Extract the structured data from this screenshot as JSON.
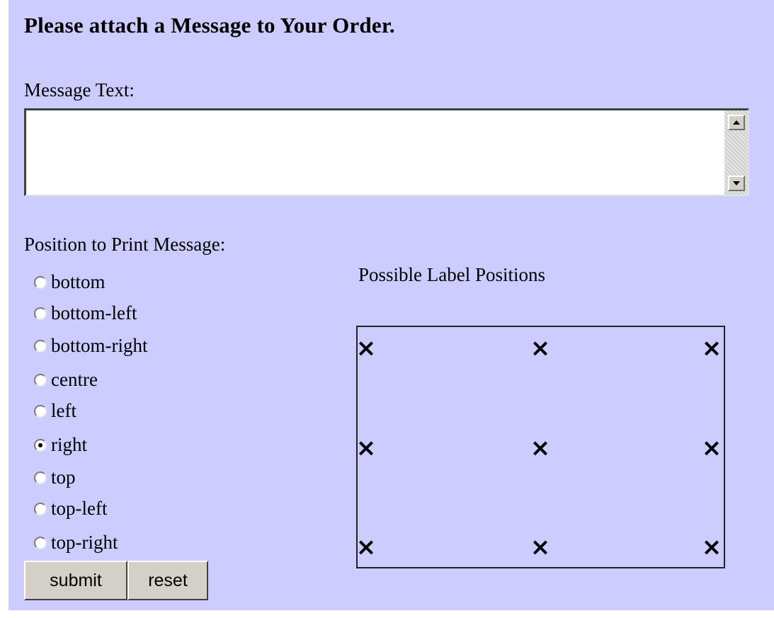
{
  "form": {
    "title": "Please attach a Message to Your Order.",
    "message_label": "Message Text:",
    "message_value": "",
    "position_label": "Position to Print Message:",
    "options": [
      "bottom",
      "bottom-left",
      "bottom-right",
      "centre",
      "left",
      "right",
      "top",
      "top-left",
      "top-right"
    ],
    "selected": "right",
    "submit_label": "submit",
    "reset_label": "reset"
  },
  "diagram": {
    "title": "Possible Label Positions",
    "marker": "×"
  },
  "icons": {
    "scroll_up": "scroll-up-arrow-icon",
    "scroll_down": "scroll-down-arrow-icon",
    "marker": "x-mark-icon"
  },
  "colors": {
    "background": "#ccccff",
    "button_face": "#d4d0c8"
  }
}
